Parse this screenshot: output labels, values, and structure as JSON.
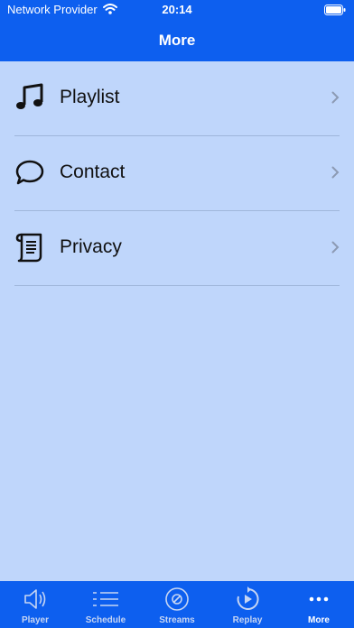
{
  "status_bar": {
    "carrier": "Network Provider",
    "time": "20:14"
  },
  "nav": {
    "title": "More"
  },
  "menu": [
    {
      "label": "Playlist",
      "icon": "music-note-icon"
    },
    {
      "label": "Contact",
      "icon": "speech-bubble-icon"
    },
    {
      "label": "Privacy",
      "icon": "scroll-document-icon"
    }
  ],
  "tabs": [
    {
      "label": "Player",
      "icon": "speaker-icon",
      "active": false
    },
    {
      "label": "Schedule",
      "icon": "list-icon",
      "active": false
    },
    {
      "label": "Streams",
      "icon": "disc-icon",
      "active": false
    },
    {
      "label": "Replay",
      "icon": "replay-icon",
      "active": false
    },
    {
      "label": "More",
      "icon": "ellipsis-icon",
      "active": true
    }
  ],
  "colors": {
    "brand": "#0d5fef",
    "background": "#bfd6fb"
  }
}
